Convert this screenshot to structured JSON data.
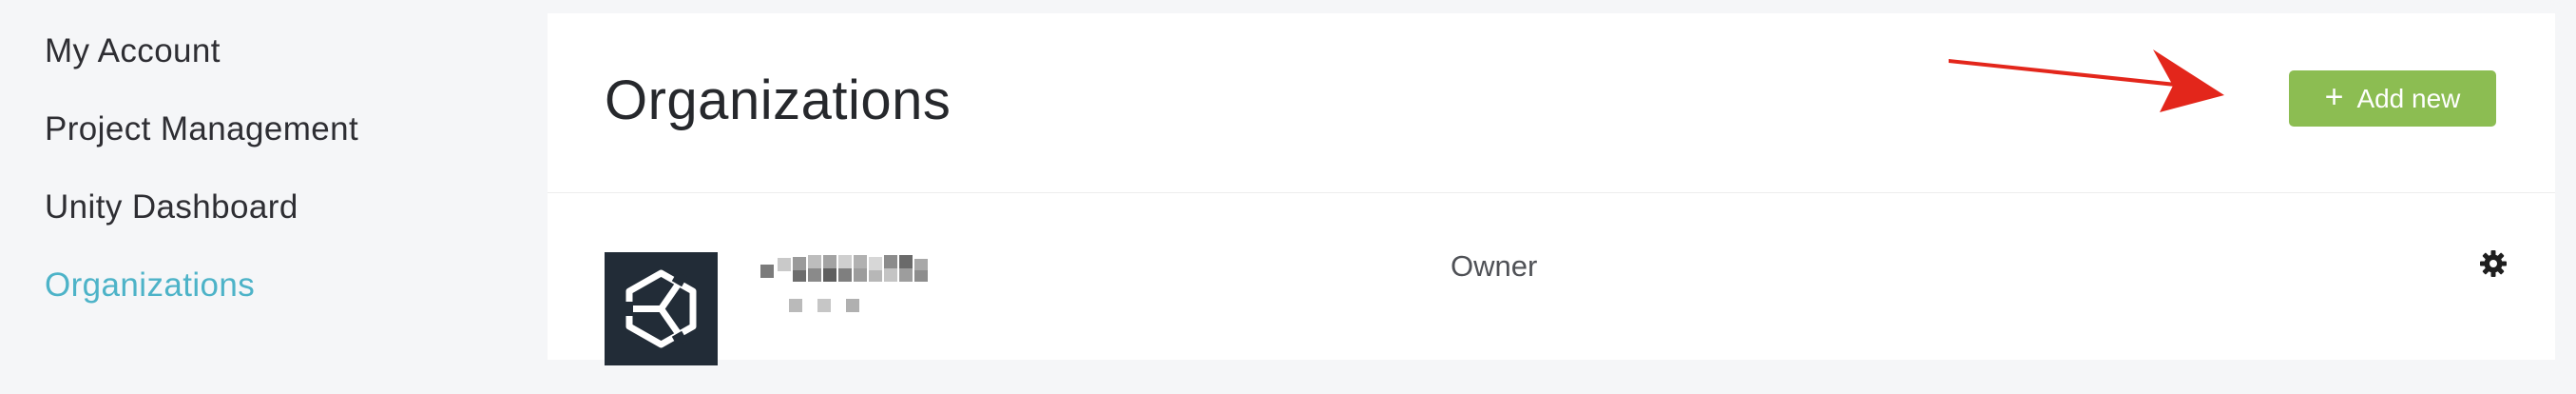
{
  "sidebar": {
    "items": [
      {
        "label": "My Account",
        "active": false
      },
      {
        "label": "Project Management",
        "active": false
      },
      {
        "label": "Unity Dashboard",
        "active": false
      },
      {
        "label": "Organizations",
        "active": true
      }
    ]
  },
  "header": {
    "title": "Organizations",
    "add_button_label": "Add new",
    "add_button_icon": "plus-icon"
  },
  "organizations": [
    {
      "role": "Owner",
      "logo_icon": "unity-logo-icon",
      "settings_icon": "gear-icon"
    }
  ],
  "colors": {
    "accent": "#4db3c8",
    "button": "#8cbd52",
    "arrow": "#e3261b",
    "logo_bg": "#222c37"
  }
}
